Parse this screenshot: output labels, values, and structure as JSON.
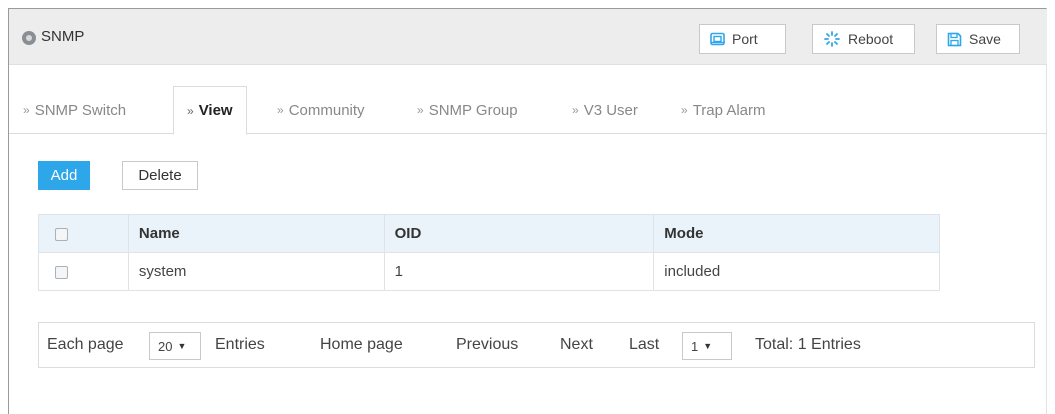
{
  "header": {
    "title": "SNMP",
    "port_label": "Port",
    "reboot_label": "Reboot",
    "save_label": "Save"
  },
  "tabs": [
    {
      "label": "SNMP Switch",
      "active": false
    },
    {
      "label": "View",
      "active": true
    },
    {
      "label": "Community",
      "active": false
    },
    {
      "label": "SNMP Group",
      "active": false
    },
    {
      "label": "V3 User",
      "active": false
    },
    {
      "label": "Trap Alarm",
      "active": false
    }
  ],
  "actions": {
    "add_label": "Add",
    "delete_label": "Delete"
  },
  "table": {
    "columns": [
      "Name",
      "OID",
      "Mode"
    ],
    "rows": [
      [
        "system",
        "1",
        "included"
      ]
    ]
  },
  "pager": {
    "each_page_label": "Each page",
    "page_size": "20",
    "entries_label": "Entries",
    "home_label": "Home page",
    "previous_label": "Previous",
    "next_label": "Next",
    "last_label": "Last",
    "current_page": "1",
    "total_label": "Total: 1 Entries"
  },
  "colors": {
    "accent": "#2ea6ea",
    "header_bg": "#ededed",
    "table_header_bg": "#eaf3f9"
  },
  "icons": {
    "title": "circle-dot-icon",
    "port": "port-icon",
    "reboot": "reboot-spinner-icon",
    "save": "floppy-disk-icon",
    "tab": "double-chevron-right-icon",
    "select": "caret-down-icon"
  }
}
